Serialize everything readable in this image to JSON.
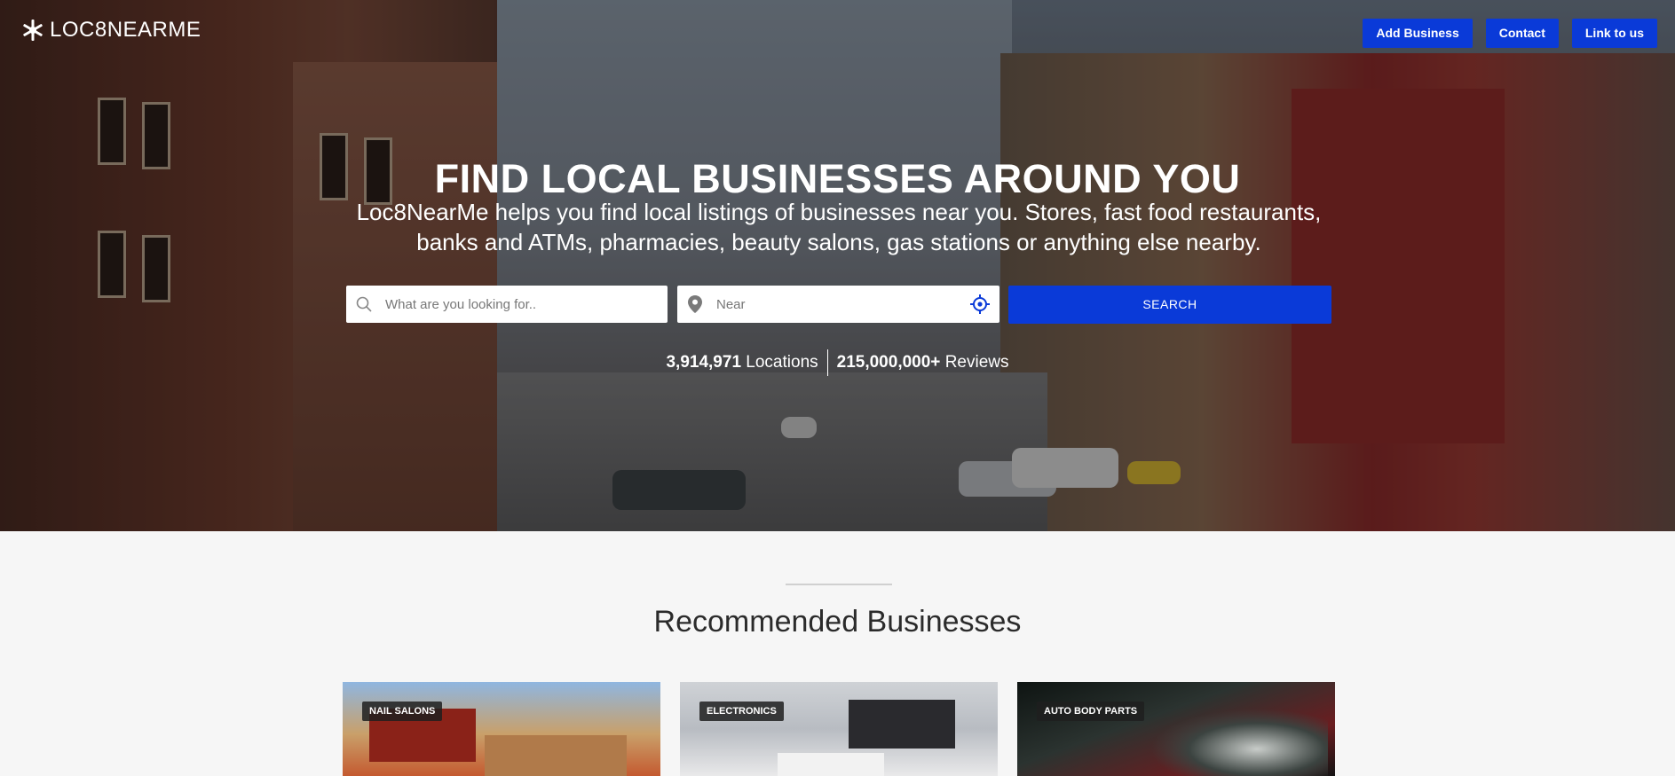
{
  "brand": {
    "name": "LOC8NEARME"
  },
  "nav": {
    "buttons": [
      {
        "label": "Add Business"
      },
      {
        "label": "Contact"
      },
      {
        "label": "Link to us"
      }
    ]
  },
  "hero": {
    "title": "FIND LOCAL BUSINESSES AROUND YOU",
    "subtitle": "Loc8NearMe helps you find local listings of businesses near you. Stores, fast food restaurants, banks and ATMs, pharmacies, beauty salons, gas stations or anything else nearby."
  },
  "search": {
    "what_placeholder": "What are you looking for..",
    "near_placeholder": "Near",
    "button_label": "SEARCH"
  },
  "stats": {
    "locations_value": "3,914,971",
    "locations_label": "Locations",
    "reviews_value": "215,000,000+",
    "reviews_label": "Reviews"
  },
  "recommended": {
    "title": "Recommended Businesses",
    "cards": [
      {
        "category": "NAIL SALONS"
      },
      {
        "category": "ELECTRONICS"
      },
      {
        "category": "AUTO BODY PARTS"
      }
    ]
  },
  "colors": {
    "accent": "#0a3ad8",
    "page_bg": "#f6f6f6"
  },
  "icons": [
    "logo-snowflake-icon",
    "search-icon",
    "map-pin-icon",
    "crosshair-locate-icon"
  ]
}
